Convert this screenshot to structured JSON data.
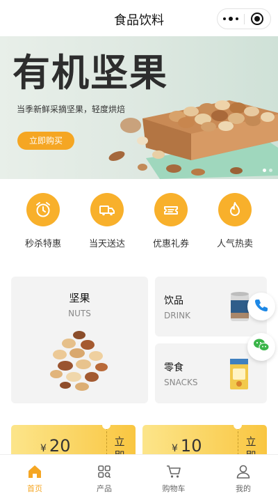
{
  "titlebar": {
    "title": "食品饮料"
  },
  "banner": {
    "headline": "有机坚果",
    "subtitle": "当季新鲜采摘坚果，轻度烘焙",
    "button": "立即购买"
  },
  "features": [
    {
      "label": "秒杀特惠",
      "icon": "alarm-clock-icon"
    },
    {
      "label": "当天送达",
      "icon": "truck-icon"
    },
    {
      "label": "优惠礼券",
      "icon": "ticket-icon"
    },
    {
      "label": "人气热卖",
      "icon": "flame-icon"
    }
  ],
  "categories": {
    "nuts": {
      "cn": "坚果",
      "en": "NUTS"
    },
    "drink": {
      "cn": "饮品",
      "en": "DRINK"
    },
    "snacks": {
      "cn": "零食",
      "en": "SNACKS"
    }
  },
  "coupons": [
    {
      "currency": "¥",
      "amount": "20",
      "action": "立即"
    },
    {
      "currency": "¥",
      "amount": "10",
      "action": "立即"
    }
  ],
  "tabbar": [
    {
      "label": "首页",
      "icon": "home-icon",
      "active": true
    },
    {
      "label": "产品",
      "icon": "grid-icon",
      "active": false
    },
    {
      "label": "购物车",
      "icon": "cart-icon",
      "active": false
    },
    {
      "label": "我的",
      "icon": "user-icon",
      "active": false
    }
  ],
  "colors": {
    "accent": "#f5a623",
    "icon_circle": "#f8b02b",
    "coupon": "#f9c641"
  }
}
